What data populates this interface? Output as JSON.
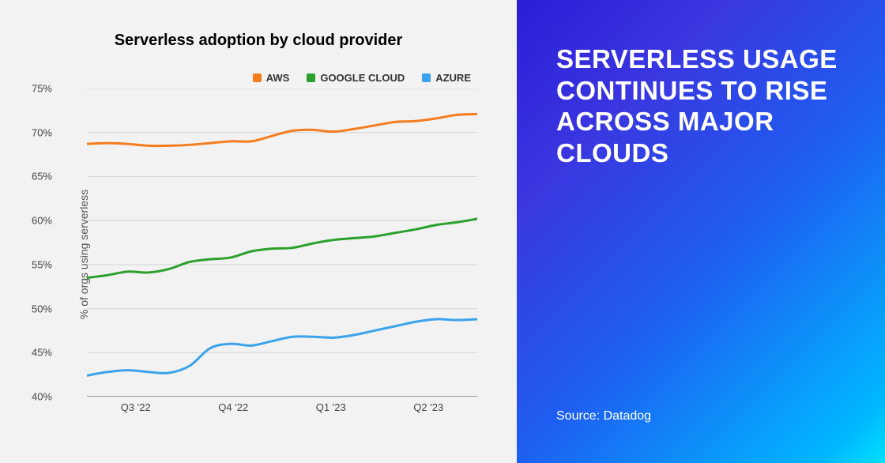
{
  "chart_data": {
    "type": "line",
    "title": "Serverless adoption by cloud provider",
    "ylabel": "% of orgs using serverless",
    "ylim": [
      40,
      75
    ],
    "yticks": [
      40,
      45,
      50,
      55,
      60,
      65,
      70,
      75
    ],
    "x_categories": [
      "Q3 '22",
      "Q4 '22",
      "Q1 '23",
      "Q2 '23"
    ],
    "series": [
      {
        "name": "AWS",
        "color": "#f57c1f",
        "values": [
          68.7,
          68.8,
          68.7,
          68.5,
          68.5,
          68.6,
          68.8,
          69.0,
          69.0,
          69.6,
          70.2,
          70.3,
          70.1,
          70.4,
          70.8,
          71.2,
          71.3,
          71.6,
          72.0,
          72.1
        ]
      },
      {
        "name": "GOOGLE CLOUD",
        "color": "#2ca02c",
        "values": [
          53.5,
          53.8,
          54.2,
          54.1,
          54.5,
          55.3,
          55.6,
          55.8,
          56.5,
          56.8,
          56.9,
          57.4,
          57.8,
          58.0,
          58.2,
          58.6,
          59.0,
          59.5,
          59.8,
          60.2
        ]
      },
      {
        "name": "AZURE",
        "color": "#3aa3ea",
        "values": [
          42.4,
          42.8,
          43.0,
          42.8,
          42.7,
          43.5,
          45.5,
          46.0,
          45.8,
          46.3,
          46.8,
          46.8,
          46.7,
          47.0,
          47.5,
          48.0,
          48.5,
          48.8,
          48.7,
          48.8
        ]
      }
    ]
  },
  "right": {
    "headline": "SERVERLESS USAGE CONTINUES TO RISE ACROSS MAJOR CLOUDS",
    "source": "Source: Datadog"
  }
}
